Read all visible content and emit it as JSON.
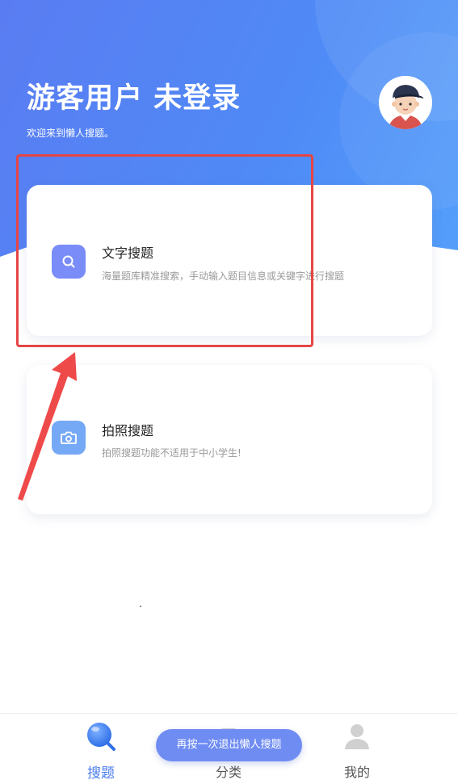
{
  "header": {
    "title": "游客用户 未登录",
    "subtitle": "欢迎来到懒人搜题。"
  },
  "cards": [
    {
      "title": "文字搜题",
      "description": "海量题库精准搜索，手动输入题目信息或关键字进行搜题",
      "icon": "search-icon"
    },
    {
      "title": "拍照搜题",
      "description": "拍照搜题功能不适用于中小学生!",
      "icon": "camera-icon"
    }
  ],
  "tabbar": {
    "items": [
      {
        "label": "搜题",
        "icon": "search-tab-icon",
        "active": true
      },
      {
        "label": "分类",
        "icon": "category-icon",
        "active": false
      },
      {
        "label": "我的",
        "icon": "profile-icon",
        "active": false
      }
    ]
  },
  "toast": {
    "text": "再按一次退出懒人搜题"
  },
  "colors": {
    "primary": "#4f8af6",
    "active_tab": "#4a7cf0",
    "highlight": "#e64545",
    "card1_icon": "#7a8cf7",
    "card2_icon": "#76a9f5"
  }
}
